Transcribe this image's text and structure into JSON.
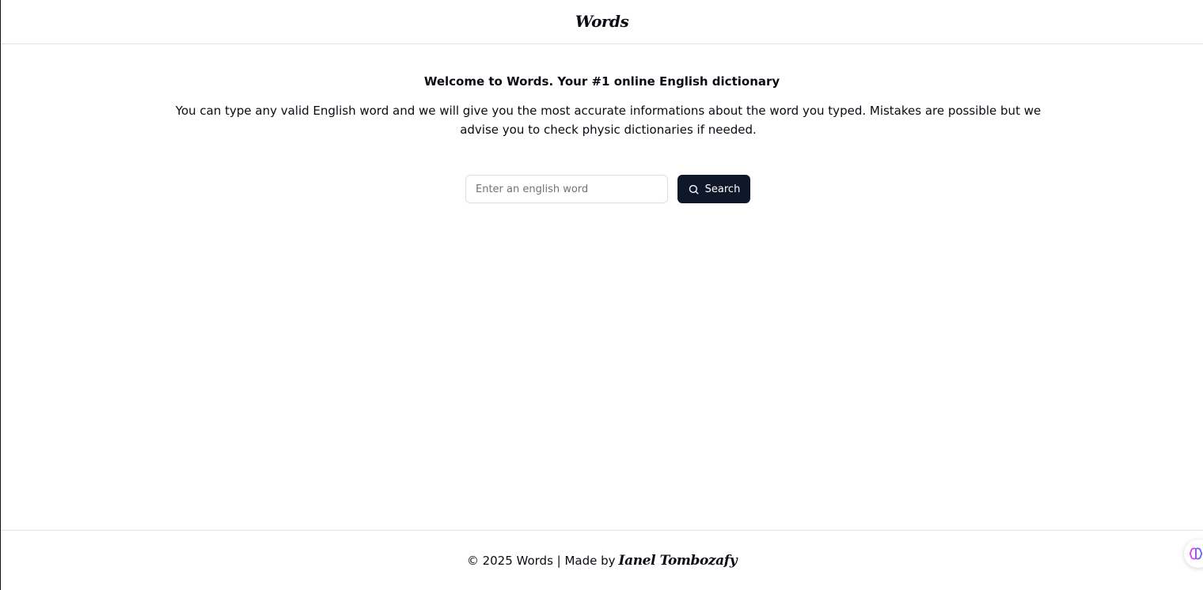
{
  "header": {
    "brand": "Words"
  },
  "main": {
    "welcome": "Welcome to Words. Your #1 online English dictionary",
    "intro": "You can type any valid English word and we will give you the most accurate informations about the word you typed. Mistakes are possible but we advise you to check physic dictionaries if needed."
  },
  "search": {
    "placeholder": "Enter an english word",
    "value": "",
    "button_label": "Search",
    "button_icon": "search-icon"
  },
  "footer": {
    "text": "© 2025 Words | Made by",
    "author": "Ianel Tombozafy"
  },
  "widget": {
    "icon": "brain-icon"
  },
  "colors": {
    "primary_button": "#0f172a",
    "text": "#0b0b14",
    "border": "#e2e2e6"
  }
}
